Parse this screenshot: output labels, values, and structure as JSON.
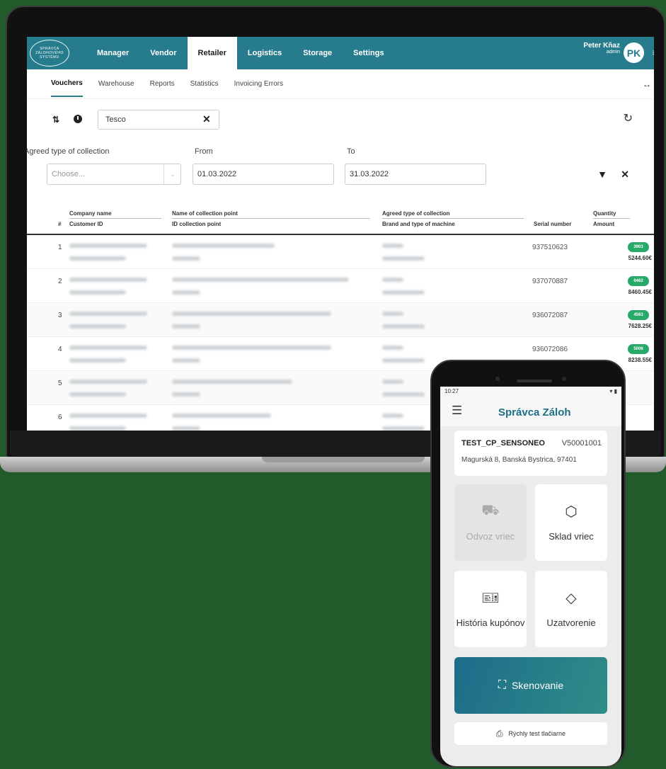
{
  "laptop": {
    "logo_text": "SPRÁVCA ZÁLOHOVÉHO SYSTÉMU",
    "nav": [
      "Manager",
      "Vendor",
      "Retailer",
      "Logistics",
      "Storage",
      "Settings"
    ],
    "user": {
      "name": "Peter Kňaz",
      "role": "admin",
      "initials": "PK"
    },
    "subnav": [
      "Vouchers",
      "Warehouse",
      "Reports",
      "Statistics",
      "Invoicing Errors"
    ],
    "search": {
      "value": "Tesco"
    },
    "filters": {
      "collection_label": "Agreed type of collection",
      "collection_placeholder": "Choose...",
      "from_label": "From",
      "from_value": "01.03.2022",
      "to_label": "To",
      "to_value": "31.03.2022"
    },
    "table": {
      "headers": {
        "num": "#",
        "company": "Company name",
        "customer": "Customer ID",
        "point": "Name of collection point",
        "point_id": "ID collection point",
        "type": "Agreed type of collection",
        "machine": "Brand and type of machine",
        "serial": "Serial number",
        "quantity": "Quantity",
        "amount": "Amount"
      },
      "rows": [
        {
          "num": "1",
          "serial": "937510623",
          "quantity": "3903",
          "amount": "5244.60€"
        },
        {
          "num": "2",
          "serial": "937070887",
          "quantity": "6462",
          "amount": "8460.45€"
        },
        {
          "num": "3",
          "serial": "936072087",
          "quantity": "4563",
          "amount": "7628.25€"
        },
        {
          "num": "4",
          "serial": "936072086",
          "quantity": "5006",
          "amount": "8238.55€"
        },
        {
          "num": "5",
          "serial": "",
          "quantity": "",
          "amount": ""
        },
        {
          "num": "6",
          "serial": "",
          "quantity": "",
          "amount": ""
        }
      ]
    }
  },
  "phone": {
    "time": "10:27",
    "title": "Správca Záloh",
    "store_code": "TEST_CP_SENSONEO",
    "store_id": "V50001001",
    "address": "Magurská 8, Banská Bystrica, 97401",
    "tiles": [
      {
        "label": "Odvoz vriec",
        "icon": "truck-icon"
      },
      {
        "label": "Sklad vriec",
        "icon": "box-icon"
      },
      {
        "label": "História kupónov",
        "icon": "ticket-icon"
      },
      {
        "label": "Uzatvorenie",
        "icon": "tag-icon"
      }
    ],
    "scan_label": "Skenovanie",
    "printer_label": "Rýchly test tlačiarne"
  }
}
